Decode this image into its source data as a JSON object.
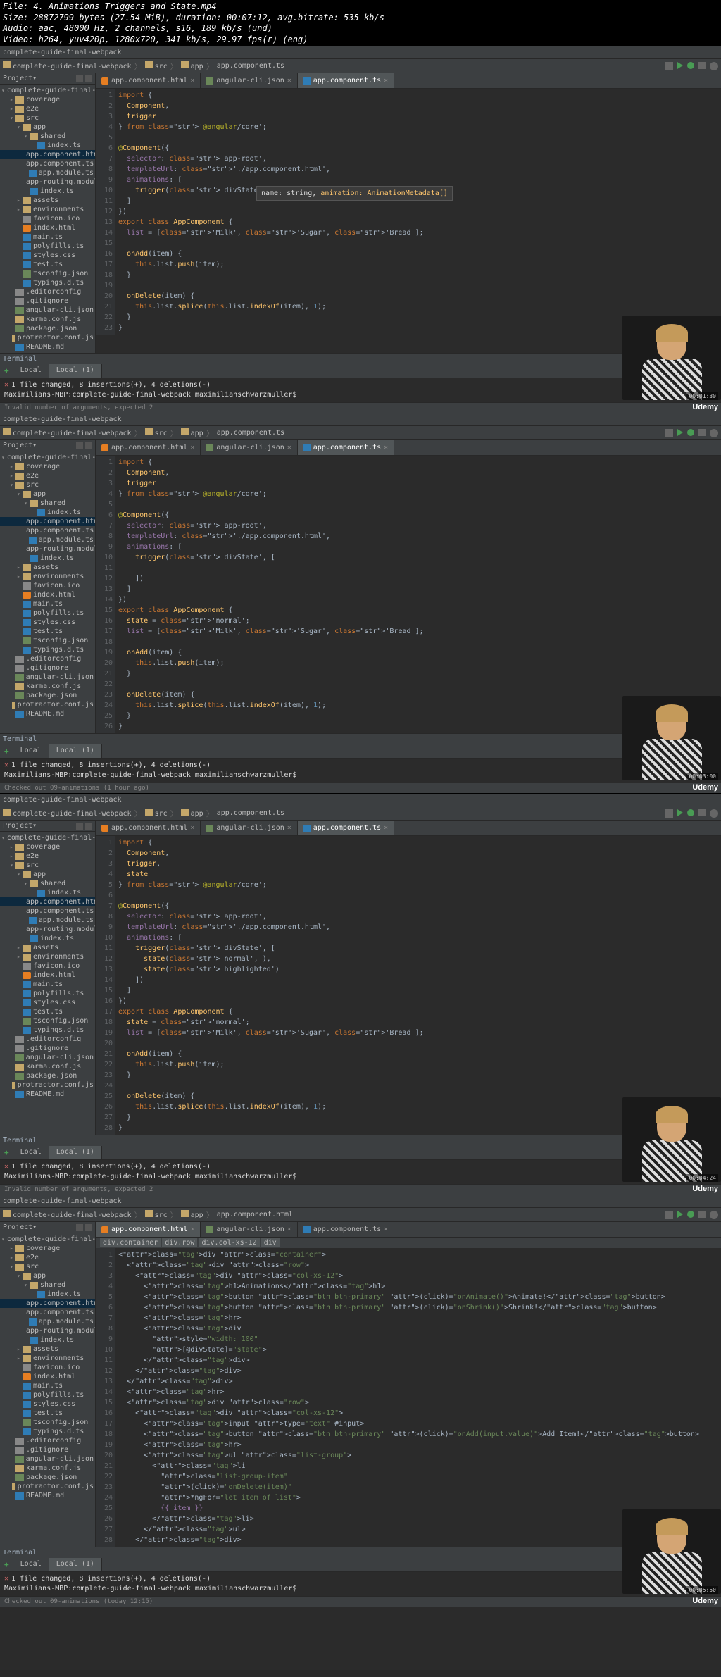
{
  "meta": {
    "file": "File: 4. Animations Triggers and State.mp4",
    "size": "Size: 28872799 bytes (27.54 MiB), duration: 00:07:12, avg.bitrate: 535 kb/s",
    "audio": "Audio: aac, 48000 Hz, 2 channels, s16, 189 kb/s (und)",
    "video": "Video: h264, yuv420p, 1280x720, 341 kb/s, 29.97 fps(r) (eng)"
  },
  "common": {
    "projectTitle": "complete-guide-final-webpack",
    "bcSrc": "src",
    "bcApp": "app",
    "projectLabel": "Project",
    "terminalLabel": "Terminal",
    "localTab": "Local",
    "local1Tab": "Local (1)",
    "gitLine": "1 file changed, 8 insertions(+), 4 deletions(-)",
    "promptLine": "Maximilians-MBP:complete-guide-final-webpack maximilianschwarzmuller$ ",
    "watermark": "Udemy"
  },
  "tree": {
    "root": "complete-guide-final-webpa",
    "items": [
      {
        "name": "coverage",
        "icon": "folder",
        "indent": 1,
        "arrow": "▸"
      },
      {
        "name": "e2e",
        "icon": "folder",
        "indent": 1,
        "arrow": "▸"
      },
      {
        "name": "src",
        "icon": "folder",
        "indent": 1,
        "arrow": "▾"
      },
      {
        "name": "app",
        "icon": "folder",
        "indent": 2,
        "arrow": "▾"
      },
      {
        "name": "shared",
        "icon": "folder",
        "indent": 3,
        "arrow": "▾"
      },
      {
        "name": "index.ts",
        "icon": "ts-file",
        "indent": 4
      },
      {
        "name": "app.component.html",
        "icon": "html-file",
        "indent": 3,
        "selected": true
      },
      {
        "name": "app.component.ts",
        "icon": "ts-file",
        "indent": 3
      },
      {
        "name": "app.module.ts",
        "icon": "ts-file",
        "indent": 3
      },
      {
        "name": "app-routing.module.t",
        "icon": "ts-file",
        "indent": 3
      },
      {
        "name": "index.ts",
        "icon": "ts-file",
        "indent": 3
      },
      {
        "name": "assets",
        "icon": "folder",
        "indent": 2,
        "arrow": "▸"
      },
      {
        "name": "environments",
        "icon": "folder",
        "indent": 2,
        "arrow": "▸"
      },
      {
        "name": "favicon.ico",
        "icon": "config-file",
        "indent": 2
      },
      {
        "name": "index.html",
        "icon": "html-file",
        "indent": 2
      },
      {
        "name": "main.ts",
        "icon": "ts-file",
        "indent": 2
      },
      {
        "name": "polyfills.ts",
        "icon": "ts-file",
        "indent": 2
      },
      {
        "name": "styles.css",
        "icon": "css-file",
        "indent": 2
      },
      {
        "name": "test.ts",
        "icon": "ts-file",
        "indent": 2
      },
      {
        "name": "tsconfig.json",
        "icon": "json-file",
        "indent": 2
      },
      {
        "name": "typings.d.ts",
        "icon": "ts-file",
        "indent": 2
      },
      {
        "name": ".editorconfig",
        "icon": "config-file",
        "indent": 1
      },
      {
        "name": ".gitignore",
        "icon": "config-file",
        "indent": 1
      },
      {
        "name": "angular-cli.json",
        "icon": "json-file",
        "indent": 1
      },
      {
        "name": "karma.conf.js",
        "icon": "js-file",
        "indent": 1
      },
      {
        "name": "package.json",
        "icon": "json-file",
        "indent": 1
      },
      {
        "name": "protractor.conf.js",
        "icon": "js-file",
        "indent": 1
      },
      {
        "name": "README.md",
        "icon": "md-file",
        "indent": 1
      }
    ]
  },
  "tabs": {
    "t1": "app.component.html",
    "t2": "angular-cli.json",
    "t3": "app.component.ts"
  },
  "frame1": {
    "bcFile": "app.component.ts",
    "activeTab": 2,
    "tooltip": "name: string, animation: AnimationMetadata[]",
    "statusError": "Invalid number of arguments, expected 2",
    "timestamp": "00:01:30",
    "code": "import {\n  Component,\n  trigger\n} from '@angular/core';\n\n@Component({\n  selector: 'app-root',\n  templateUrl: './app.component.html',\n  animations: [\n    trigger('divState', )\n  ]\n})\nexport class AppComponent {\n  list = ['Milk', 'Sugar', 'Bread'];\n\n  onAdd(item) {\n    this.list.push(item);\n  }\n\n  onDelete(item) {\n    this.list.splice(this.list.indexOf(item), 1);\n  }\n}\n"
  },
  "frame2": {
    "bcFile": "app.component.ts",
    "activeTab": 2,
    "statusGit": "Checked out 09-animations (1 hour ago)",
    "timestamp": "00:03:00",
    "code": "import {\n  Component,\n  trigger\n} from '@angular/core';\n\n@Component({\n  selector: 'app-root',\n  templateUrl: './app.component.html',\n  animations: [\n    trigger('divState', [\n\n    ])\n  ]\n})\nexport class AppComponent {\n  state = 'normal';\n  list = ['Milk', 'Sugar', 'Bread'];\n\n  onAdd(item) {\n    this.list.push(item);\n  }\n\n  onDelete(item) {\n    this.list.splice(this.list.indexOf(item), 1);\n  }\n}\n"
  },
  "frame3": {
    "bcFile": "app.component.ts",
    "activeTab": 2,
    "statusError": "Invalid number of arguments, expected 2",
    "timestamp": "00:04:24",
    "code": "import {\n  Component,\n  trigger,\n  state\n} from '@angular/core';\n\n@Component({\n  selector: 'app-root',\n  templateUrl: './app.component.html',\n  animations: [\n    trigger('divState', [\n      state('normal', ),\n      state('highlighted')\n    ])\n  ]\n})\nexport class AppComponent {\n  state = 'normal';\n  list = ['Milk', 'Sugar', 'Bread'];\n\n  onAdd(item) {\n    this.list.push(item);\n  }\n\n  onDelete(item) {\n    this.list.splice(this.list.indexOf(item), 1);\n  }\n}\n"
  },
  "frame4": {
    "bcFile": "app.component.html",
    "activeTab": 0,
    "statusGit": "Checked out 09-animations (today 12:15)",
    "timestamp": "00:05:50",
    "bcPath": [
      "div.container",
      "div.row",
      "div.col-xs-12",
      "div"
    ],
    "code": "<div class=\"container\">\n  <div class=\"row\">\n    <div class=\"col-xs-12\">\n      <h1>Animations</h1>\n      <button class=\"btn btn-primary\" (click)=\"onAnimate()\">Animate!</button>\n      <button class=\"btn btn-primary\" (click)=\"onShrink()\">Shrink!</button>\n      <hr>\n      <div\n        style=\"width: 100\"\n        [@divState]=\"state\">\n      </div>\n    </div>\n  </div>\n  <hr>\n  <div class=\"row\">\n    <div class=\"col-xs-12\">\n      <input type=\"text\" #input>\n      <button class=\"btn btn-primary\" (click)=\"onAdd(input.value)\">Add Item!</button>\n      <hr>\n      <ul class=\"list-group\">\n        <li\n          class=\"list-group-item\"\n          (click)=\"onDelete(item)\"\n          *ngFor=\"let item of list\">\n          {{ item }}\n        </li>\n      </ul>\n    </div>\n"
  }
}
